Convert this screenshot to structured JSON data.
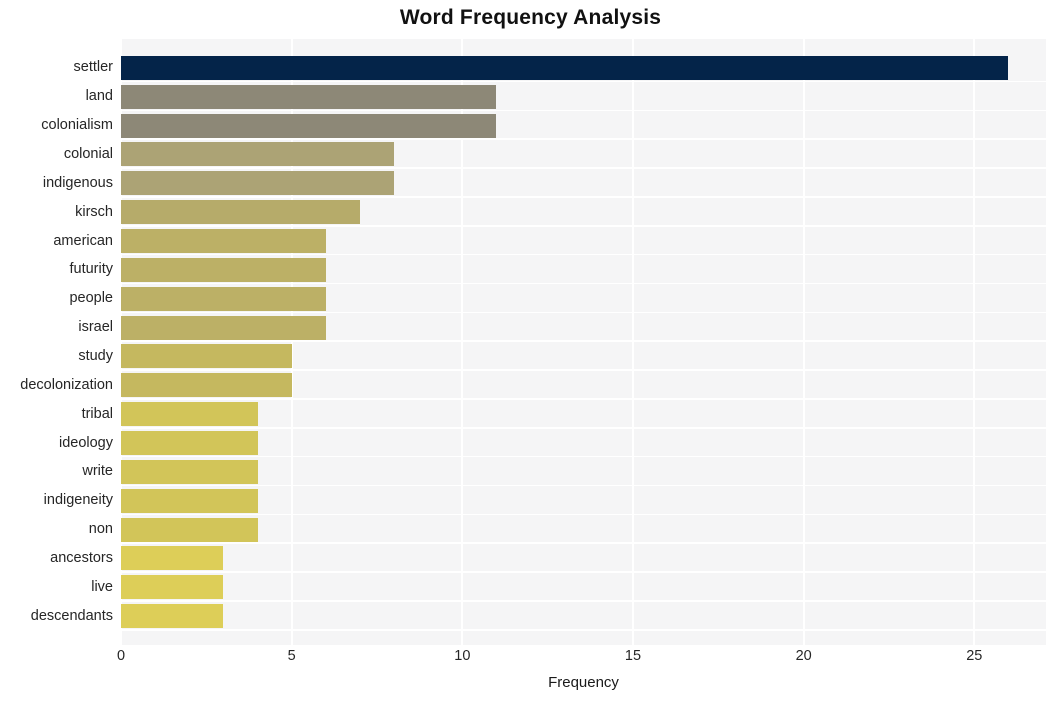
{
  "chart_data": {
    "type": "bar",
    "orientation": "horizontal",
    "title": "Word Frequency Analysis",
    "xlabel": "Frequency",
    "ylabel": "",
    "xlim": [
      0,
      27.1
    ],
    "ylim": null,
    "grid": true,
    "legend": false,
    "legend_position": "none",
    "xticks": [
      0,
      5,
      10,
      15,
      20,
      25
    ],
    "xtick_labels": [
      "0",
      "5",
      "10",
      "15",
      "20",
      "25"
    ],
    "categories": [
      "settler",
      "land",
      "colonialism",
      "colonial",
      "indigenous",
      "kirsch",
      "american",
      "futurity",
      "people",
      "israel",
      "study",
      "decolonization",
      "tribal",
      "ideology",
      "write",
      "indigeneity",
      "non",
      "ancestors",
      "live",
      "descendants"
    ],
    "values": [
      26,
      11,
      11,
      8,
      8,
      7,
      6,
      6,
      6,
      6,
      5,
      5,
      4,
      4,
      4,
      4,
      4,
      3,
      3,
      3
    ],
    "bar_colors": [
      "#042449",
      "#8d8877",
      "#8d8877",
      "#aca375",
      "#aca375",
      "#b6ab6a",
      "#bcb066",
      "#bcb066",
      "#bcb066",
      "#bcb066",
      "#c5b85f",
      "#c5b85f",
      "#d2c559",
      "#d2c559",
      "#d2c559",
      "#d2c559",
      "#d2c559",
      "#ddce58",
      "#ddce58",
      "#ddce58"
    ]
  },
  "style": {
    "figure_background": "#ffffff",
    "plot_background": "#f5f5f6",
    "gridline_color": "#ffffff",
    "title_color": "#111111",
    "tick_label_color": "#262626",
    "axis_label_color": "#1a1a1a"
  }
}
